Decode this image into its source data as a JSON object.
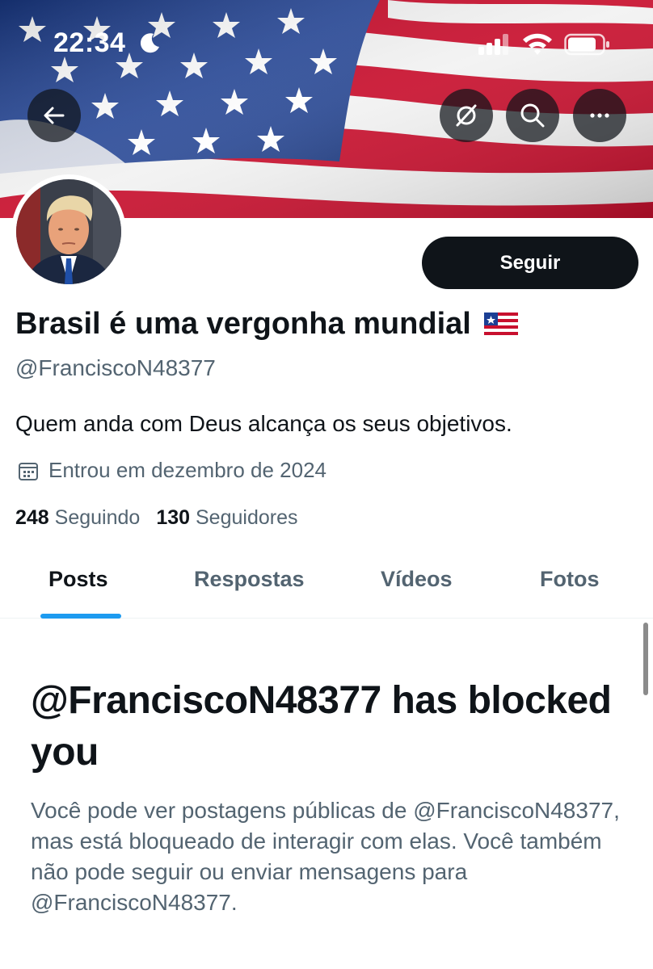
{
  "status_bar": {
    "time": "22:34",
    "icons": [
      "moon-icon",
      "signal-icon",
      "wifi-icon",
      "battery-icon"
    ]
  },
  "header": {
    "banner": "american-flag-banner",
    "buttons": [
      "back-arrow-icon",
      "translate-icon",
      "search-icon",
      "more-icon"
    ]
  },
  "profile": {
    "display_name": "Brasil é uma vergonha mundial",
    "handle": "@FranciscoN48377",
    "bio": "Quem anda com Deus alcança os seus objetivos.",
    "joined": "Entrou em dezembro de 2024",
    "following_count": "248",
    "following_label": "Seguindo",
    "followers_count": "130",
    "followers_label": "Seguidores",
    "follow_button": "Seguir"
  },
  "tabs": [
    {
      "label": "Posts",
      "active": true
    },
    {
      "label": "Respostas",
      "active": false
    },
    {
      "label": "Vídeos",
      "active": false
    },
    {
      "label": "Fotos",
      "active": false
    }
  ],
  "blocked": {
    "title": "@FranciscoN48377 has blocked you",
    "description": "Você pode ver postagens públicas de @FranciscoN48377, mas está bloqueado de interagir com elas. Você também não pode seguir ou enviar mensagens para @FranciscoN48377."
  },
  "colors": {
    "text_primary": "#0f1419",
    "text_secondary": "#536471",
    "accent": "#1d9bf0",
    "button_dark": "#0f1419"
  }
}
